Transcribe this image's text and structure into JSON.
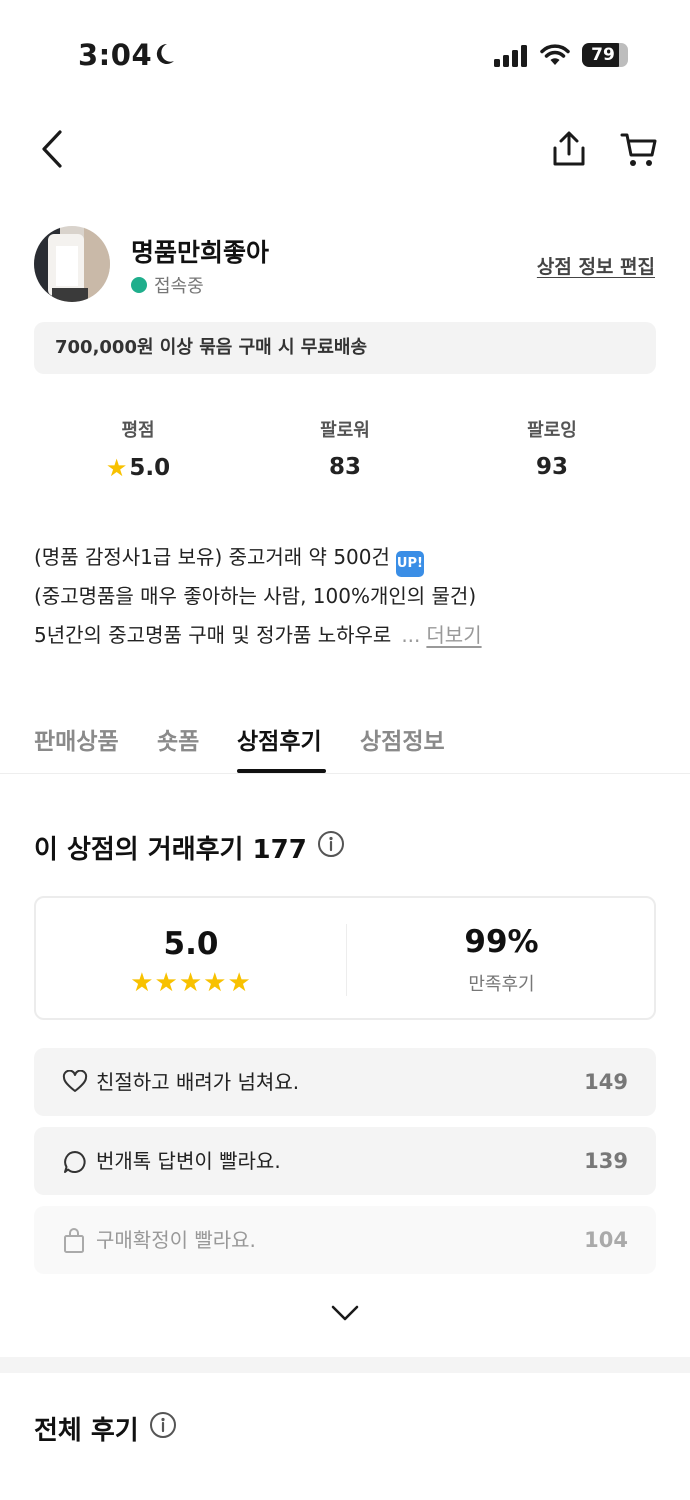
{
  "status_bar": {
    "time": "3:04",
    "battery": "79"
  },
  "store": {
    "name": "명품만희좋아",
    "online_status": "접속중",
    "edit_link": "상점 정보 편집",
    "shipping_banner": "700,000원 이상 묶음 구매 시 무료배송"
  },
  "stats": {
    "rating_label": "평점",
    "rating_value": "5.0",
    "followers_label": "팔로워",
    "followers_value": "83",
    "following_label": "팔로잉",
    "following_value": "93"
  },
  "bio": {
    "line1": "(명품 감정사1급 보유) 중고거래 약 500건",
    "line1_badge": "UP!",
    "line2": "(중고명품을 매우 좋아하는 사람, 100%개인의 물건)",
    "line3": "5년간의 중고명품 구매 및 정가품 노하우로",
    "ellipsis": "...",
    "more": "더보기"
  },
  "tabs": [
    {
      "label": "판매상품",
      "active": false
    },
    {
      "label": "숏폼",
      "active": false
    },
    {
      "label": "상점후기",
      "active": true
    },
    {
      "label": "상점정보",
      "active": false
    }
  ],
  "reviews": {
    "title": "이 상점의 거래후기 177",
    "score": "5.0",
    "stars": "★★★★★",
    "satisfaction": "99%",
    "satisfaction_label": "만족후기",
    "items": [
      {
        "icon": "heart-icon",
        "text": "친절하고 배려가 넘쳐요.",
        "count": "149"
      },
      {
        "icon": "chat-bubble-icon",
        "text": "번개톡 답변이 빨라요.",
        "count": "139"
      },
      {
        "icon": "shopping-bag-icon",
        "text": "구매확정이 빨라요.",
        "count": "104"
      }
    ],
    "all_title": "전체 후기"
  },
  "colors": {
    "online_dot": "#1fae8c",
    "star": "#f8c100",
    "up_badge": "#3a8ee6"
  }
}
